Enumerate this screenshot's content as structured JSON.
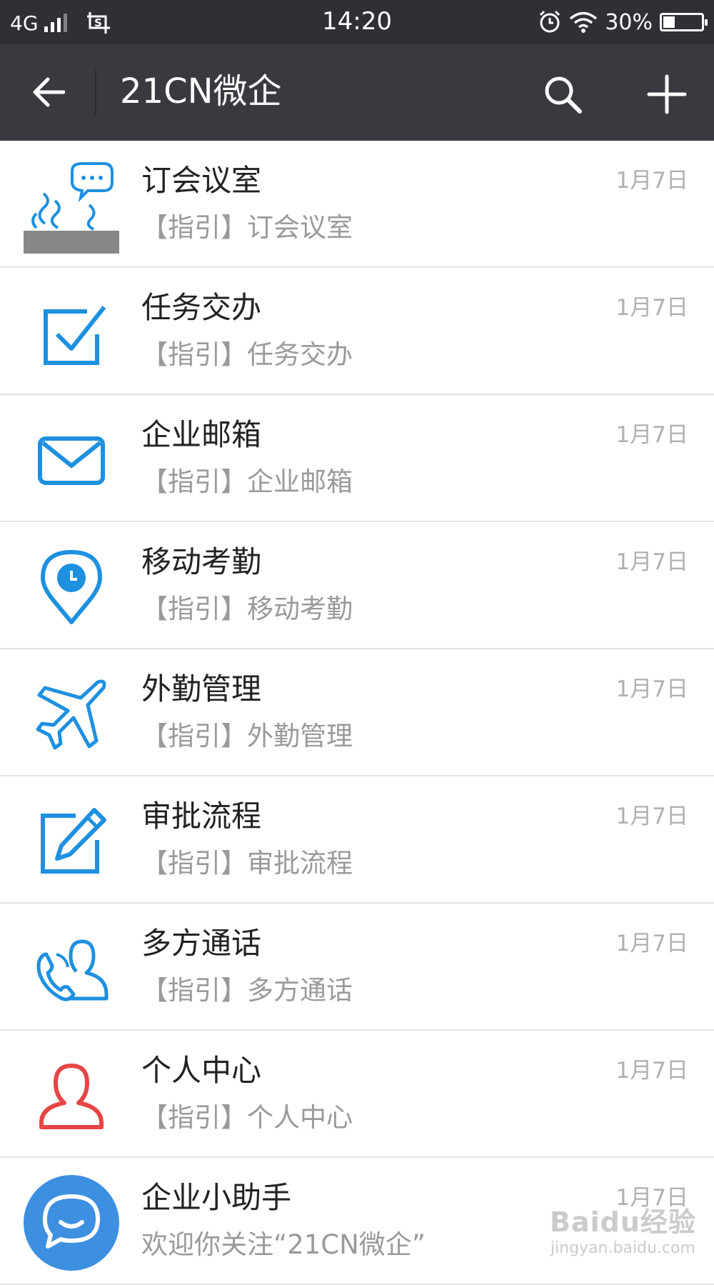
{
  "status_bar": {
    "network": "4G",
    "time": "14:20",
    "battery": "30%",
    "battery_level": 0.3
  },
  "header": {
    "title": "21CN微企"
  },
  "messages": [
    {
      "title": "订会议室",
      "subtitle": "【指引】订会议室",
      "date": "1月7日",
      "icon": "meeting-room-icon"
    },
    {
      "title": "任务交办",
      "subtitle": "【指引】任务交办",
      "date": "1月7日",
      "icon": "checkbox-icon"
    },
    {
      "title": "企业邮箱",
      "subtitle": "【指引】企业邮箱",
      "date": "1月7日",
      "icon": "mail-icon"
    },
    {
      "title": "移动考勤",
      "subtitle": "【指引】移动考勤",
      "date": "1月7日",
      "icon": "location-clock-icon"
    },
    {
      "title": "外勤管理",
      "subtitle": "【指引】外勤管理",
      "date": "1月7日",
      "icon": "airplane-icon"
    },
    {
      "title": "审批流程",
      "subtitle": "【指引】审批流程",
      "date": "1月7日",
      "icon": "edit-icon"
    },
    {
      "title": "多方通话",
      "subtitle": "【指引】多方通话",
      "date": "1月7日",
      "icon": "conference-call-icon"
    },
    {
      "title": "个人中心",
      "subtitle": "【指引】个人中心",
      "date": "1月7日",
      "icon": "person-icon"
    },
    {
      "title": "企业小助手",
      "subtitle": "欢迎你关注“21CN微企”",
      "date": "1月7日",
      "icon": "chat-bubble-icon"
    }
  ],
  "colors": {
    "accent": "#1e90e0",
    "header": "#393a3f",
    "status": "#2e3035",
    "person": "#e64545",
    "assistant": "#3d8fe0"
  },
  "watermark": {
    "brand": "Baidu经验",
    "site": "jingyan.baidu.com"
  }
}
